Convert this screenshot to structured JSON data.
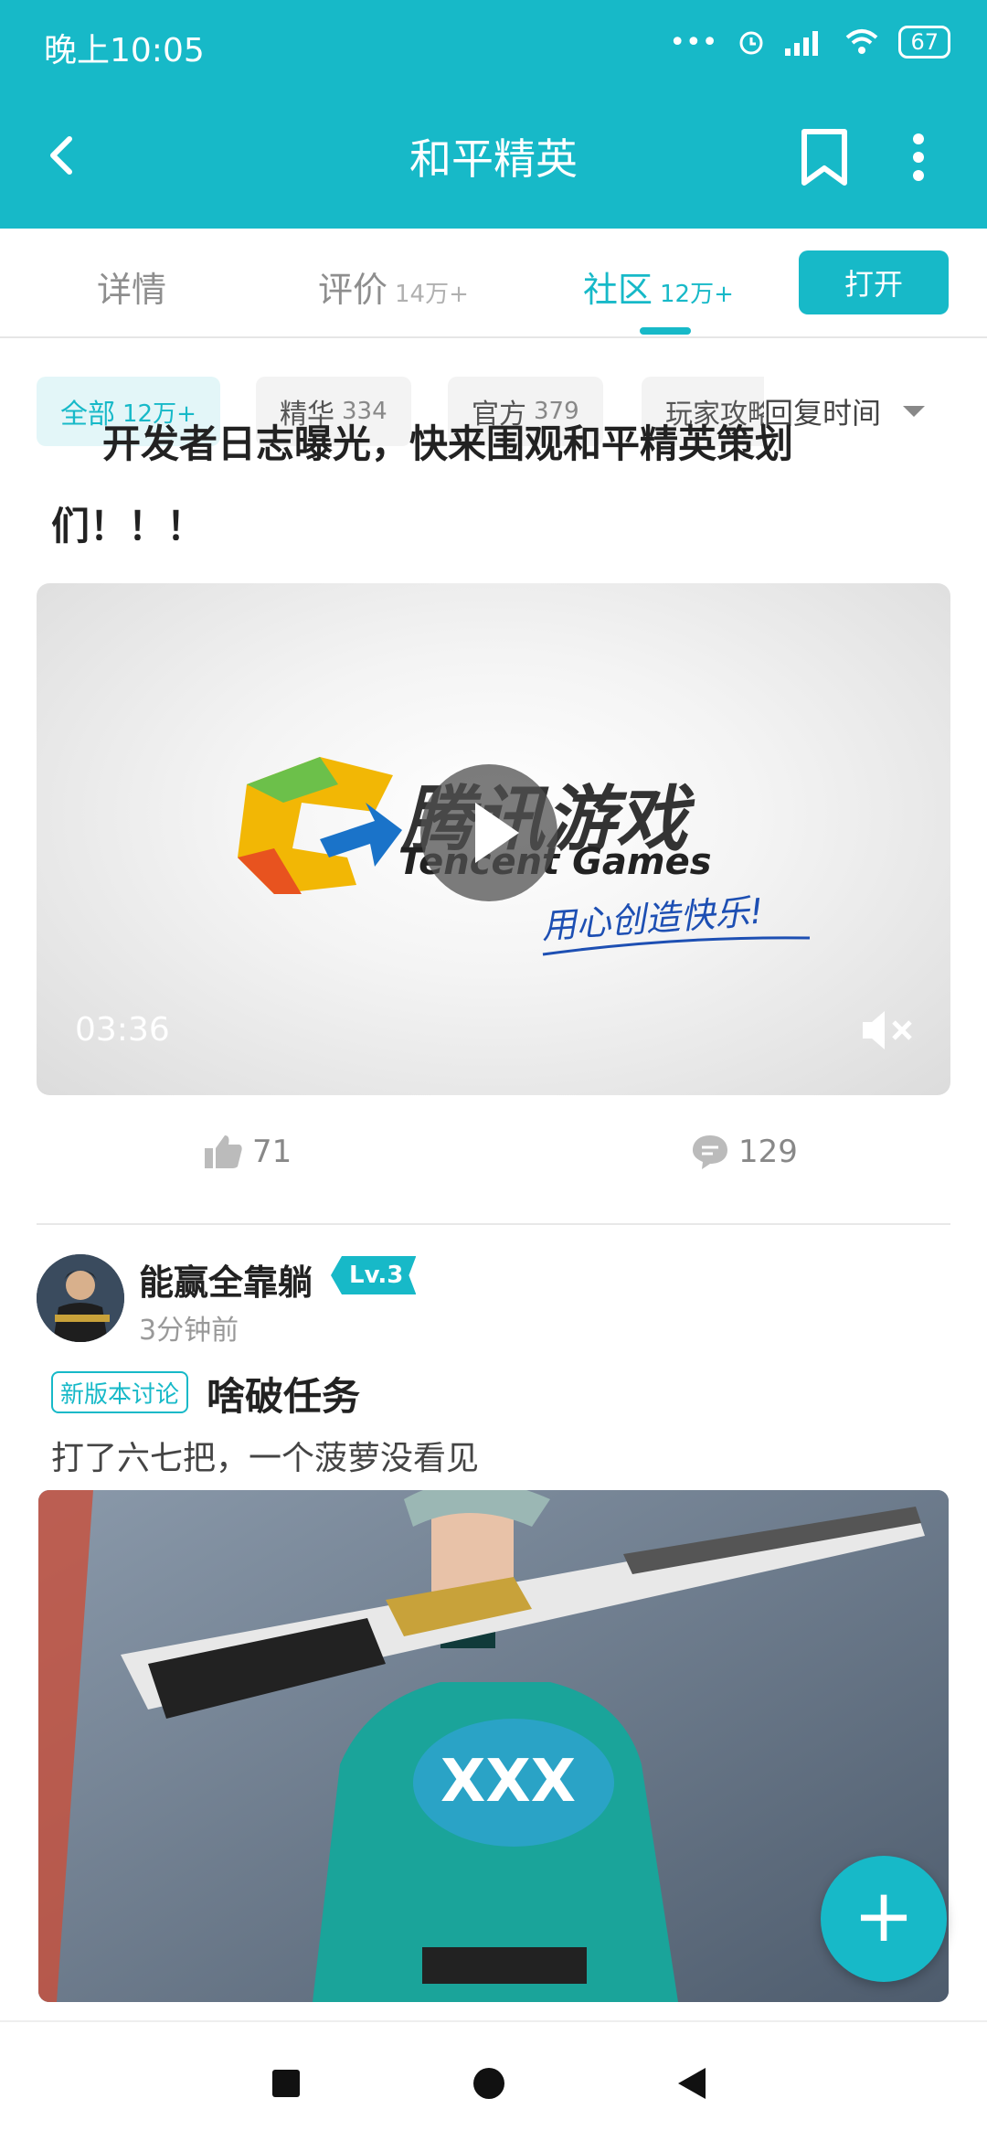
{
  "status_bar": {
    "time": "晚上10:05",
    "battery": "67",
    "icons": [
      "more-dots-icon",
      "alarm-icon",
      "signal-icon",
      "wifi-icon",
      "battery-icon"
    ]
  },
  "app_bar": {
    "title": "和平精英",
    "icons": [
      "back-arrow-icon",
      "bookmark-icon",
      "more-vertical-icon"
    ]
  },
  "tabs": [
    {
      "label": "详情",
      "count": ""
    },
    {
      "label": "评价",
      "count": "14万+"
    },
    {
      "label": "社区",
      "count": "12万+"
    }
  ],
  "active_tab": "社区",
  "open_button": "打开",
  "filters": [
    {
      "label": "全部",
      "count": "12万+"
    },
    {
      "label": "精华",
      "count": "334"
    },
    {
      "label": "官方",
      "count": "379"
    },
    {
      "label": "玩家攻略",
      "count": ""
    }
  ],
  "active_filter": "全部",
  "sort": {
    "label": "回复时间"
  },
  "post1": {
    "title_line1": "开发者日志曝光，快来围观和平精英策划",
    "title_line2": "们！！！",
    "video": {
      "duration": "03:36",
      "logo_cn": "腾讯游戏",
      "logo_en": "Tencent Games",
      "slogan": "用心创造快乐!"
    },
    "likes": "71",
    "comments": "129"
  },
  "post2": {
    "username": "能赢全靠躺",
    "level": "Lv.3",
    "time": "3分钟前",
    "tag": "新版本讨论",
    "title": "啥破任务",
    "body": "打了六七把，一个菠萝没看见",
    "image_text": "XXX"
  },
  "fab_label": "+",
  "nav_bar": {
    "icons": [
      "recents-square-icon",
      "home-circle-icon",
      "back-triangle-icon"
    ]
  },
  "colors": {
    "accent": "#17b9c8",
    "text": "#222222",
    "muted": "#999999"
  }
}
